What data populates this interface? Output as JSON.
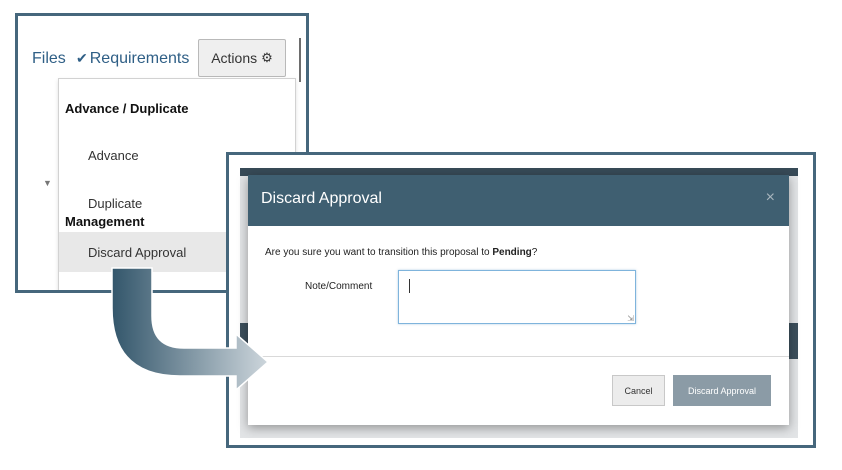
{
  "tabs": {
    "files_label": "Files",
    "requirements_label": "Requirements",
    "requirements_icon": "checkmark-icon",
    "actions_label": "Actions",
    "actions_icon": "gear-icon"
  },
  "dropdown": {
    "sections": [
      {
        "header": "Advance / Duplicate",
        "items": [
          "Advance",
          "Duplicate"
        ]
      },
      {
        "header": "Management",
        "items": [
          "Discard Approval"
        ]
      }
    ],
    "active_item": "Discard Approval"
  },
  "modal": {
    "title": "Discard Approval",
    "close_icon": "close-icon",
    "question_prefix": "Are you sure you want to transition this proposal to ",
    "question_status": "Pending",
    "question_suffix": "?",
    "note_label": "Note/Comment",
    "note_value": "",
    "cancel_label": "Cancel",
    "discard_label": "Discard Approval"
  },
  "colors": {
    "callout_border": "#46677c",
    "modal_header": "#3f5f71",
    "link_blue": "#2f5f86",
    "discard_button": "#8b9ba6"
  }
}
